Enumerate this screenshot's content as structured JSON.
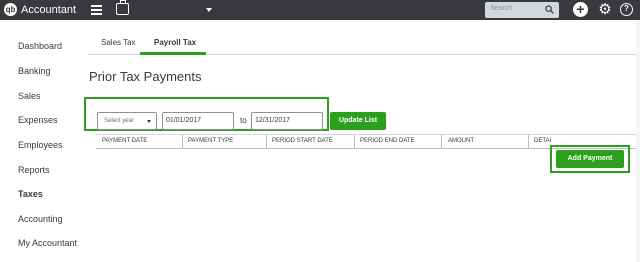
{
  "app": {
    "logo": "qb",
    "name": "Accountant",
    "company_caret": "chevron-down-icon"
  },
  "topbar": {
    "search_placeholder": "Search",
    "icons": [
      "menu-icon",
      "briefcase-icon",
      "search-icon",
      "plus-icon",
      "gear-icon",
      "help-icon"
    ],
    "help_glyph": "?"
  },
  "sidebar": {
    "items": [
      {
        "label": "Dashboard",
        "active": false
      },
      {
        "label": "Banking",
        "active": false
      },
      {
        "label": "Sales",
        "active": false
      },
      {
        "label": "Expenses",
        "active": false
      },
      {
        "label": "Employees",
        "active": false
      },
      {
        "label": "Reports",
        "active": false
      },
      {
        "label": "Taxes",
        "active": true
      },
      {
        "label": "Accounting",
        "active": false
      },
      {
        "label": "My Accountant",
        "active": false
      }
    ]
  },
  "tabs": [
    {
      "label": "Sales Tax",
      "active": false
    },
    {
      "label": "Payroll Tax",
      "active": true
    }
  ],
  "main": {
    "title": "Prior Tax Payments",
    "filter": {
      "year_select": "Select year",
      "from_date": "01/01/2017",
      "to_label": "to",
      "to_date": "12/31/2017",
      "update_button": "Update List"
    },
    "table": {
      "columns": [
        "PAYMENT DATE",
        "PAYMENT TYPE",
        "PERIOD START DATE",
        "PERIOD END DATE",
        "AMOUNT",
        "DETAI"
      ]
    },
    "add_button": "Add Payment"
  },
  "colors": {
    "topbar": "#393a3d",
    "accent": "#2ca01c",
    "text": "#393a3d"
  }
}
